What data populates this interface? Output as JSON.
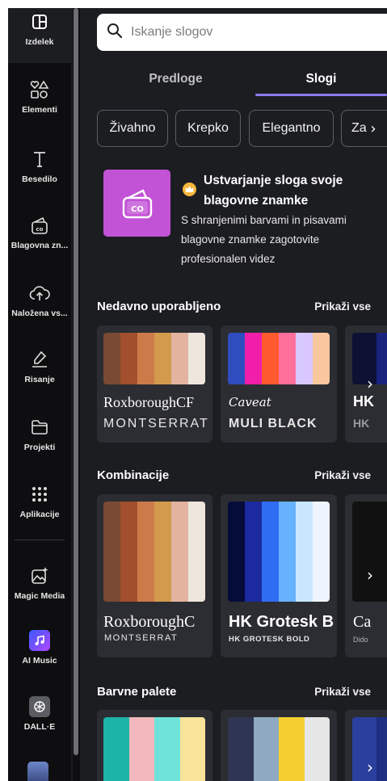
{
  "sidebar": {
    "items": [
      {
        "label": "Izdelek",
        "icon": "layout-icon"
      },
      {
        "label": "Elementi",
        "icon": "shapes-icon"
      },
      {
        "label": "Besedilo",
        "icon": "text-icon"
      },
      {
        "label": "Blagovna zn...",
        "icon": "brand-icon"
      },
      {
        "label": "Naložena vs...",
        "icon": "upload-cloud-icon"
      },
      {
        "label": "Risanje",
        "icon": "draw-icon"
      },
      {
        "label": "Projekti",
        "icon": "folder-icon"
      },
      {
        "label": "Aplikacije",
        "icon": "apps-grid-icon"
      },
      {
        "label": "Magic Media",
        "icon": "magic-media-icon"
      },
      {
        "label": "AI Music",
        "icon": "ai-music-icon"
      },
      {
        "label": "DALL·E",
        "icon": "dalle-icon"
      }
    ]
  },
  "search": {
    "placeholder": "Iskanje slogov"
  },
  "tabs": [
    {
      "label": "Predloge"
    },
    {
      "label": "Slogi"
    }
  ],
  "chips": [
    {
      "label": "Živahno"
    },
    {
      "label": "Krepko"
    },
    {
      "label": "Elegantno"
    },
    {
      "label": "Za"
    }
  ],
  "promo": {
    "title": "Ustvarjanje sloga svoje blagovne znamke",
    "description": "S shranjenimi barvami in pisavami blagovne znamke zagotovite profesionalen videz",
    "image_text": "CO"
  },
  "sections": {
    "recent": {
      "title": "Nedavno uporabljeno",
      "link": "Prikaži vse",
      "cards": [
        {
          "colors": [
            "#7a4a34",
            "#a14f2c",
            "#cc7a4a",
            "#d29a4c",
            "#e2b4a0",
            "#efe6dd"
          ],
          "font1": "RoxboroughCF",
          "font2": "MONTSERRAT"
        },
        {
          "colors": [
            "#2f4dbf",
            "#f01ea8",
            "#ff5a2e",
            "#ff6f9a",
            "#d8c8ff",
            "#f9c79e"
          ],
          "font1": "Caveat",
          "font2": "MULI BLACK"
        },
        {
          "colors": [
            "#0d1133",
            "#1a237e"
          ],
          "font1": "HK",
          "font2": "HK"
        }
      ]
    },
    "combos": {
      "title": "Kombinacije",
      "link": "Prikaži vse",
      "cards": [
        {
          "colors": [
            "#7a4a34",
            "#a14f2c",
            "#cc7a4a",
            "#d29a4c",
            "#e2b4a0",
            "#efe6dd"
          ],
          "font1": "RoxboroughC",
          "font2": "MONTSERRAT"
        },
        {
          "colors": [
            "#050c3a",
            "#1b2a9e",
            "#2f6df2",
            "#66b2ff",
            "#c9e6ff",
            "#eef4ff"
          ],
          "font1": "HK Grotesk B",
          "font2": "HK GROTESK BOLD"
        },
        {
          "colors": [
            "#111111"
          ],
          "font1": "Ca",
          "font2": "Dido"
        }
      ]
    },
    "palettes": {
      "title": "Barvne palete",
      "link": "Prikaži vse",
      "cards": [
        {
          "colors": [
            "#1cb3a8",
            "#f3b8bd",
            "#6fe3d9",
            "#f8e39a"
          ]
        },
        {
          "colors": [
            "#2f3653",
            "#8fa9c2",
            "#f5cf32",
            "#e6e6e6"
          ]
        },
        {
          "colors": [
            "#2a3f9e",
            "#1e2f82"
          ]
        }
      ]
    }
  }
}
